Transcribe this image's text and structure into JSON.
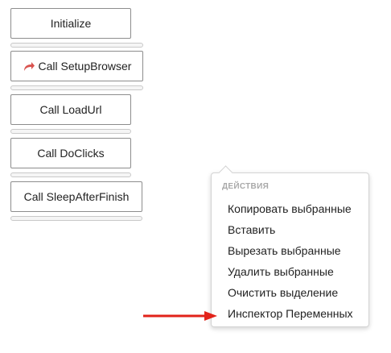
{
  "actions": [
    {
      "label": "Initialize",
      "progress": 0
    },
    {
      "label": "Call SetupBrowser",
      "progress": 0,
      "icon": "redirect-arrow-icon",
      "icon_color": "#d9534f"
    },
    {
      "label": "Call LoadUrl",
      "progress": 0
    },
    {
      "label": "Call DoClicks",
      "progress": 0
    },
    {
      "label": "Call SleepAfterFinish",
      "progress": 0
    }
  ],
  "context_menu": {
    "header": "ДЕЙСТВИЯ",
    "items": [
      "Копировать выбранные",
      "Вставить",
      "Вырезать выбранные",
      "Удалить выбранные",
      "Очистить выделение",
      "Инспектор Переменных"
    ]
  },
  "annotation": {
    "arrow_color": "#e2231a",
    "points_to": "Инспектор Переменных"
  }
}
